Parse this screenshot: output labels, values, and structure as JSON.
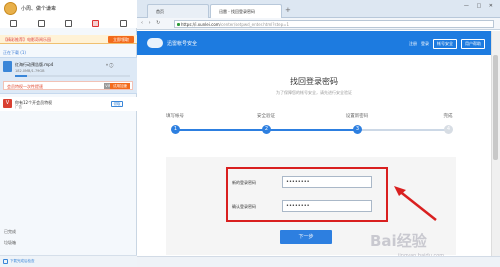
{
  "client": {
    "username": "小周、做个谦卑",
    "ad": {
      "text": "【精彩推荐】电影奇闻乐园",
      "button": "立即领取"
    },
    "downloading_header": "正在下载 (1)",
    "download": {
      "file_name": "红海行动预告版.mp4",
      "size": "182.0MB/1.79GB",
      "progress": 0.1,
      "banner_text": "会员特权一次性提速",
      "vip_tag": "VIP",
      "banner_button": "试用加速"
    },
    "vip_promo": {
      "icon": "V",
      "title": "你有12个开会员特权",
      "sub": "广告",
      "button": "领取"
    },
    "done_label": "已完成",
    "trash_label": "垃圾箱",
    "status_text": "下载完成后检查"
  },
  "browser": {
    "tabs": [
      {
        "label": "首页"
      },
      {
        "label": "迅雷 - 找回登录密码"
      }
    ],
    "new_tab": "+",
    "window_buttons": "— □ ✕",
    "nav": "‹ › ↻",
    "url_main": "https://i.xunlei.com",
    "url_rest": "/center/setpwd_enter.html?step=1"
  },
  "site": {
    "brand": "迅雷帐号安全",
    "links": [
      "注册",
      "登录"
    ],
    "buttons": [
      "帐号安全",
      "用户帮助"
    ]
  },
  "page": {
    "title": "找回登录密码",
    "subtitle": "为了保障您的帐号安全，请先进行安全验证",
    "steps": [
      {
        "n": "1",
        "label": "填写帐号"
      },
      {
        "n": "2",
        "label": "安全验证"
      },
      {
        "n": "3",
        "label": "设置新密码"
      },
      {
        "n": "4",
        "label": "完成"
      }
    ],
    "current_step": 3,
    "fields": [
      {
        "label": "新的登录密码",
        "value": "••••••••"
      },
      {
        "label": "确认登录密码",
        "value": "••••••••"
      }
    ],
    "next_button": "下一步"
  },
  "watermark": {
    "main": "Bai经验",
    "sub": "jingyan.baidu.com"
  },
  "colors": {
    "accent": "#1d7be0",
    "highlight": "#d92020",
    "cta": "#f36b1c"
  }
}
